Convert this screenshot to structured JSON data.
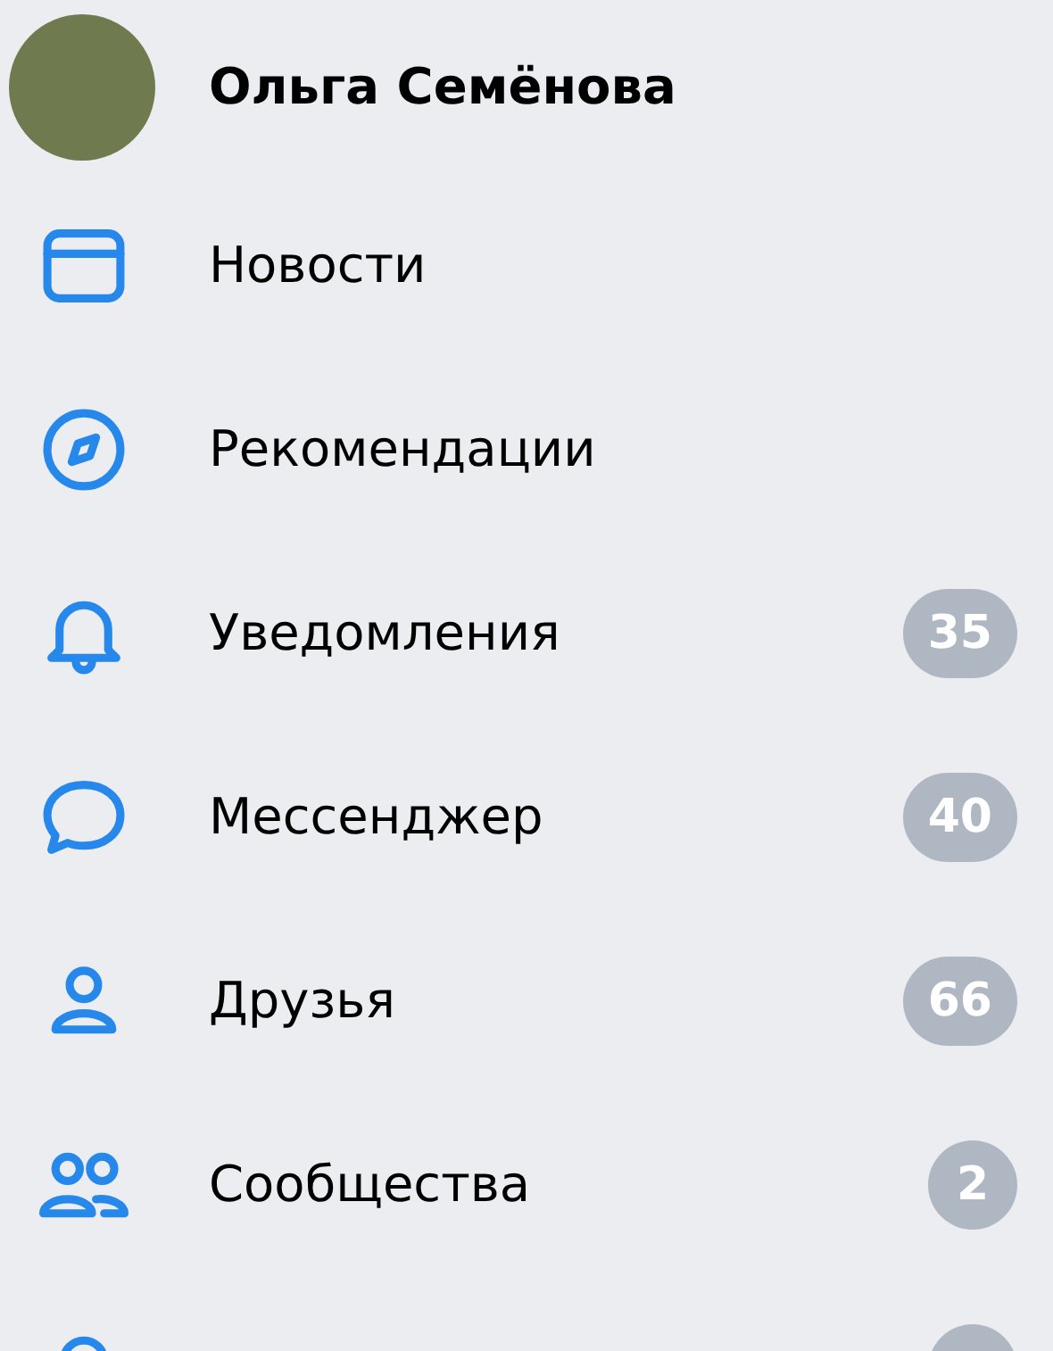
{
  "profile": {
    "name": "Ольга Семёнова"
  },
  "menu": [
    {
      "label": "Новости"
    },
    {
      "label": "Рекомендации"
    },
    {
      "label": "Уведомления",
      "count": "35"
    },
    {
      "label": "Мессенджер",
      "count": "40"
    },
    {
      "label": "Друзья",
      "count": "66"
    },
    {
      "label": "Сообщества",
      "count": "2"
    },
    {
      "has_badge": true
    }
  ]
}
